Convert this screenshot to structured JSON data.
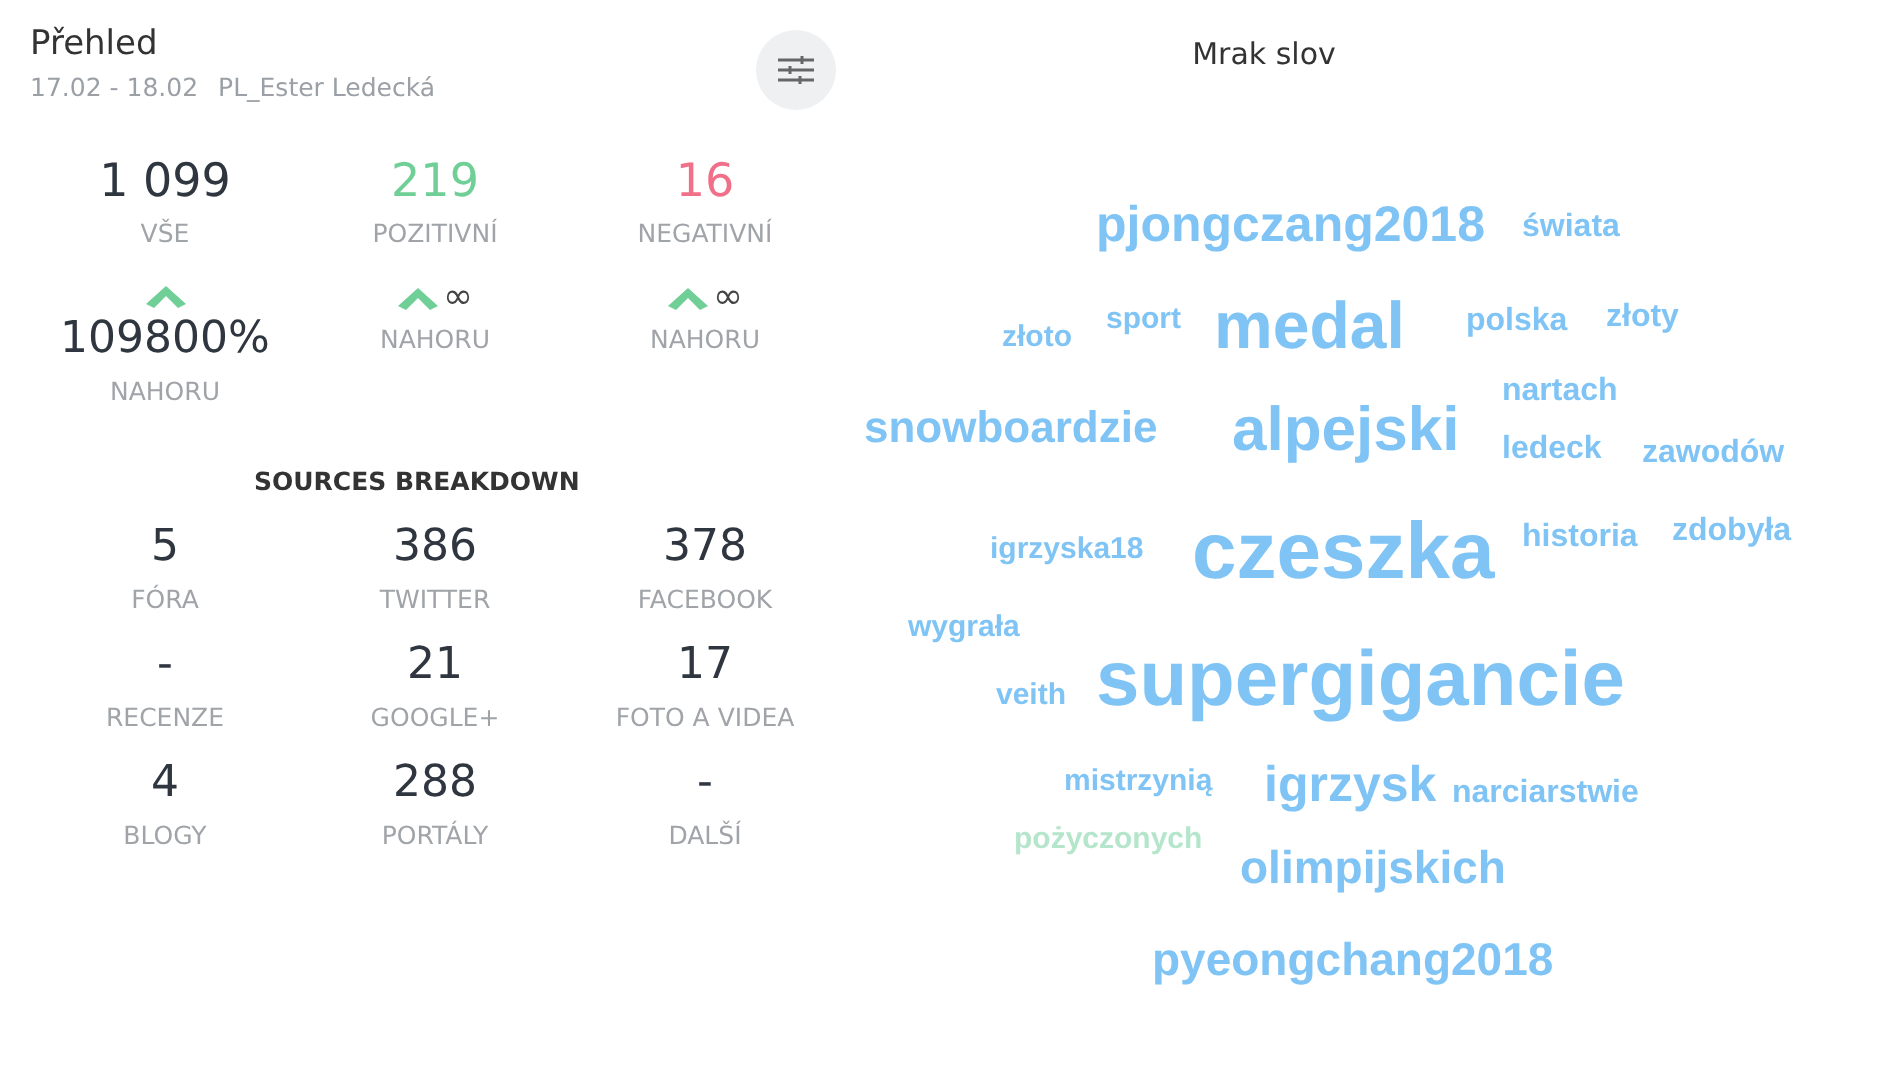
{
  "overview": {
    "title": "Přehled",
    "date_range": "17.02 - 18.02",
    "project": "PL_Ester Ledecká",
    "totals": [
      {
        "value": "1 099",
        "label": "VŠE",
        "kind": "all"
      },
      {
        "value": "219",
        "label": "POZITIVNÍ",
        "kind": "positive"
      },
      {
        "value": "16",
        "label": "NEGATIVNÍ",
        "kind": "negative"
      }
    ],
    "trends": [
      {
        "value": "109800%",
        "label": "NAHORU",
        "kind": "up"
      },
      {
        "value": "∞",
        "label": "NAHORU",
        "kind": "up"
      },
      {
        "value": "∞",
        "label": "NAHORU",
        "kind": "up"
      }
    ]
  },
  "sources_breakdown": {
    "title": "SOURCES BREAKDOWN",
    "items": [
      {
        "value": "5",
        "label": "FÓRA"
      },
      {
        "value": "386",
        "label": "TWITTER"
      },
      {
        "value": "378",
        "label": "FACEBOOK"
      },
      {
        "value": "-",
        "label": "RECENZE"
      },
      {
        "value": "21",
        "label": "GOOGLE+"
      },
      {
        "value": "17",
        "label": "FOTO A VIDEA"
      },
      {
        "value": "4",
        "label": "BLOGY"
      },
      {
        "value": "288",
        "label": "PORTÁLY"
      },
      {
        "value": "-",
        "label": "DALŠÍ"
      }
    ]
  },
  "word_cloud": {
    "title": "Mrak slov",
    "words": [
      {
        "text": "pjongczang2018",
        "color": "#7fc4f5"
      },
      {
        "text": "świata",
        "color": "#7fc4f5"
      },
      {
        "text": "złoto",
        "color": "#7fc4f5"
      },
      {
        "text": "sport",
        "color": "#7fc4f5"
      },
      {
        "text": "medal",
        "color": "#7fc4f5"
      },
      {
        "text": "polska",
        "color": "#7fc4f5"
      },
      {
        "text": "złoty",
        "color": "#7fc4f5"
      },
      {
        "text": "nartach",
        "color": "#7fc4f5"
      },
      {
        "text": "snowboardzie",
        "color": "#7fc4f5"
      },
      {
        "text": "alpejski",
        "color": "#7fc4f5"
      },
      {
        "text": "ledeck",
        "color": "#7fc4f5"
      },
      {
        "text": "zawodów",
        "color": "#7fc4f5"
      },
      {
        "text": "igrzyska18",
        "color": "#7fc4f5"
      },
      {
        "text": "czeszka",
        "color": "#7fc4f5"
      },
      {
        "text": "historia",
        "color": "#7fc4f5"
      },
      {
        "text": "zdobyła",
        "color": "#7fc4f5"
      },
      {
        "text": "wygrała",
        "color": "#7fc4f5"
      },
      {
        "text": "veith",
        "color": "#7fc4f5"
      },
      {
        "text": "supergigancie",
        "color": "#7fc4f5"
      },
      {
        "text": "mistrzynią",
        "color": "#7fc4f5"
      },
      {
        "text": "igrzysk",
        "color": "#7fc4f5"
      },
      {
        "text": "narciarstwie",
        "color": "#7fc4f5"
      },
      {
        "text": "pożyczonych",
        "color": "#b5e6cc"
      },
      {
        "text": "olimpijskich",
        "color": "#7fc4f5"
      },
      {
        "text": "pyeongchang2018",
        "color": "#7fc4f5"
      }
    ]
  }
}
